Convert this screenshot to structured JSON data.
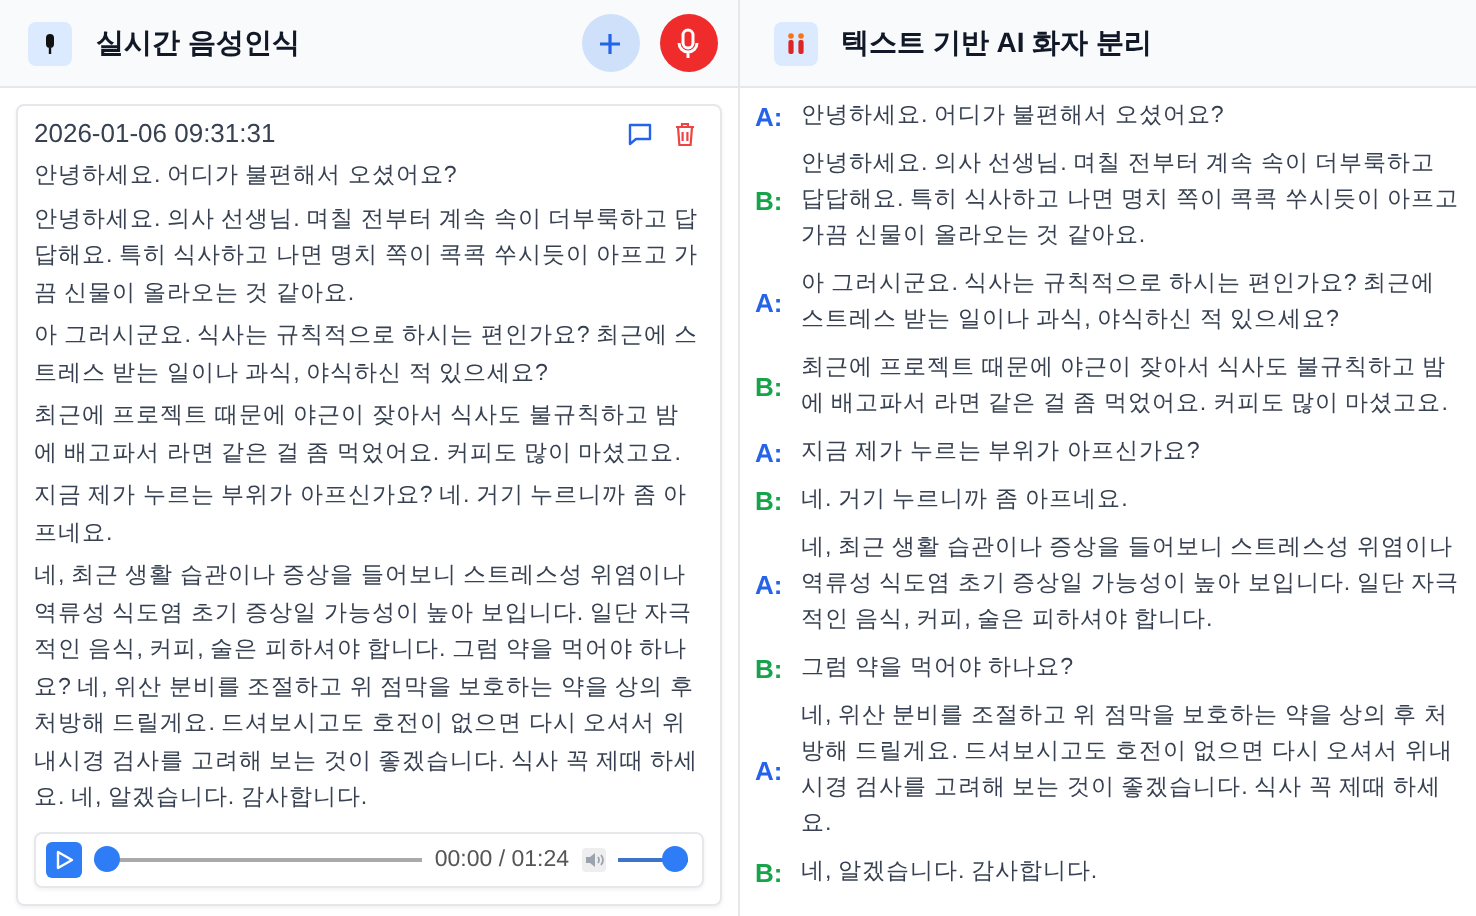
{
  "left_panel": {
    "title": "실시간 음성인식",
    "record": {
      "timestamp": "2026-01-06 09:31:31",
      "paragraphs": [
        "안녕하세요. 어디가 불편해서 오셨어요?",
        "안녕하세요. 의사 선생님. 며칠 전부터 계속 속이 더부룩하고 답답해요. 특히 식사하고 나면 명치 쪽이 콕콕 쑤시듯이 아프고 가끔 신물이 올라오는 것 같아요.",
        "아 그러시군요. 식사는 규칙적으로 하시는 편인가요? 최근에 스트레스 받는 일이나 과식, 야식하신 적 있으세요?",
        "최근에 프로젝트 때문에 야근이 잦아서 식사도 불규칙하고 밤에 배고파서 라면 같은 걸 좀 먹었어요. 커피도 많이 마셨고요.",
        "지금 제가 누르는 부위가 아프신가요? 네. 거기 누르니까 좀 아프네요.",
        "네, 최근 생활 습관이나 증상을 들어보니 스트레스성 위염이나 역류성 식도염 초기 증상일 가능성이 높아 보입니다. 일단 자극적인 음식, 커피, 술은 피하셔야 합니다. 그럼 약을 먹어야 하나요? 네, 위산 분비를 조절하고 위 점막을 보호하는 약을 상의 후 처방해 드릴게요. 드셔보시고도 호전이 없으면 다시 오셔서 위내시경 검사를 고려해 보는 것이 좋겠습니다. 식사 꼭 제때 하세요. 네, 알겠습니다. 감사합니다."
      ],
      "player": {
        "time": "00:00 / 01:24",
        "progress": {
          "level": 0
        },
        "volume": {
          "level": 1
        }
      }
    }
  },
  "right_panel": {
    "title": "텍스트 기반 AI 화자 분리",
    "utterances": [
      {
        "speaker": "A:",
        "color": "#2563eb",
        "text": "안녕하세요. 어디가 불편해서 오셨어요?"
      },
      {
        "speaker": "B:",
        "color": "#16a34a",
        "text": "안녕하세요. 의사 선생님. 며칠 전부터 계속 속이 더부룩하고 답답해요. 특히 식사하고 나면 명치 쪽이 콕콕 쑤시듯이 아프고 가끔 신물이 올라오는 것 같아요."
      },
      {
        "speaker": "A:",
        "color": "#2563eb",
        "text": "아 그러시군요. 식사는 규칙적으로 하시는 편인가요? 최근에 스트레스 받는 일이나 과식, 야식하신 적 있으세요?"
      },
      {
        "speaker": "B:",
        "color": "#16a34a",
        "text": "최근에 프로젝트 때문에 야근이 잦아서 식사도 불규칙하고 밤에 배고파서 라면 같은 걸 좀 먹었어요. 커피도 많이 마셨고요."
      },
      {
        "speaker": "A:",
        "color": "#2563eb",
        "text": "지금 제가 누르는 부위가 아프신가요?"
      },
      {
        "speaker": "B:",
        "color": "#16a34a",
        "text": "네. 거기 누르니까 좀 아프네요."
      },
      {
        "speaker": "A:",
        "color": "#2563eb",
        "text": "네, 최근 생활 습관이나 증상을 들어보니 스트레스성 위염이나 역류성 식도염 초기 증상일 가능성이 높아 보입니다. 일단 자극적인 음식, 커피, 술은 피하셔야 합니다."
      },
      {
        "speaker": "B:",
        "color": "#16a34a",
        "text": "그럼 약을 먹어야 하나요?"
      },
      {
        "speaker": "A:",
        "color": "#2563eb",
        "text": "네, 위산 분비를 조절하고 위 점막을 보호하는 약을 상의 후 처방해 드릴게요. 드셔보시고도 호전이 없으면 다시 오셔서 위내시경 검사를 고려해 보는 것이 좋겠습니다. 식사 꼭 제때 하세요."
      },
      {
        "speaker": "B:",
        "color": "#16a34a",
        "text": "네, 알겠습니다. 감사합니다."
      }
    ]
  }
}
